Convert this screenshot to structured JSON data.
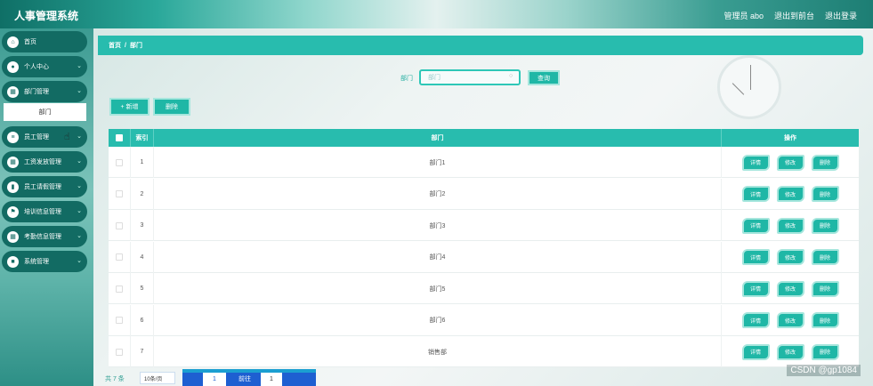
{
  "header": {
    "title": "人事管理系统",
    "links": [
      "管理员 abo",
      "退出到前台",
      "退出登录"
    ]
  },
  "sidebar": {
    "items": [
      {
        "label": "首页",
        "icon": "home-icon"
      },
      {
        "label": "个人中心",
        "icon": "user-icon"
      },
      {
        "label": "部门管理",
        "icon": "grid-icon"
      },
      {
        "label": "员工管理",
        "icon": "list-icon"
      },
      {
        "label": "工资发放管理",
        "icon": "grid-icon"
      },
      {
        "label": "员工请假管理",
        "icon": "chart-icon"
      },
      {
        "label": "培训信息管理",
        "icon": "flag-icon"
      },
      {
        "label": "考勤信息管理",
        "icon": "grid-icon"
      },
      {
        "label": "系统管理",
        "icon": "square-icon"
      }
    ],
    "sub_item": "部门"
  },
  "breadcrumb": {
    "home": "首页",
    "sep": "/",
    "current": "部门"
  },
  "search": {
    "label": "部门",
    "placeholder": "部门",
    "button": "查询"
  },
  "actions": {
    "add": "+ 新增",
    "delete": "删除"
  },
  "table": {
    "headers": {
      "index": "索引",
      "dept": "部门",
      "ops": "操作"
    },
    "rows": [
      {
        "index": "1",
        "dept": "部门1"
      },
      {
        "index": "2",
        "dept": "部门2"
      },
      {
        "index": "3",
        "dept": "部门3"
      },
      {
        "index": "4",
        "dept": "部门4"
      },
      {
        "index": "5",
        "dept": "部门5"
      },
      {
        "index": "6",
        "dept": "部门6"
      },
      {
        "index": "7",
        "dept": "销售部"
      }
    ],
    "op_labels": {
      "detail": "详情",
      "edit": "修改",
      "delete": "删除"
    }
  },
  "pager": {
    "total": "共 7 条",
    "size": "10条/页",
    "page": "1",
    "goto": "前往",
    "goto_value": "1"
  },
  "watermark": "CSDN @gp1084",
  "colors": {
    "accent": "#28bcae",
    "dark": "#126b63"
  }
}
